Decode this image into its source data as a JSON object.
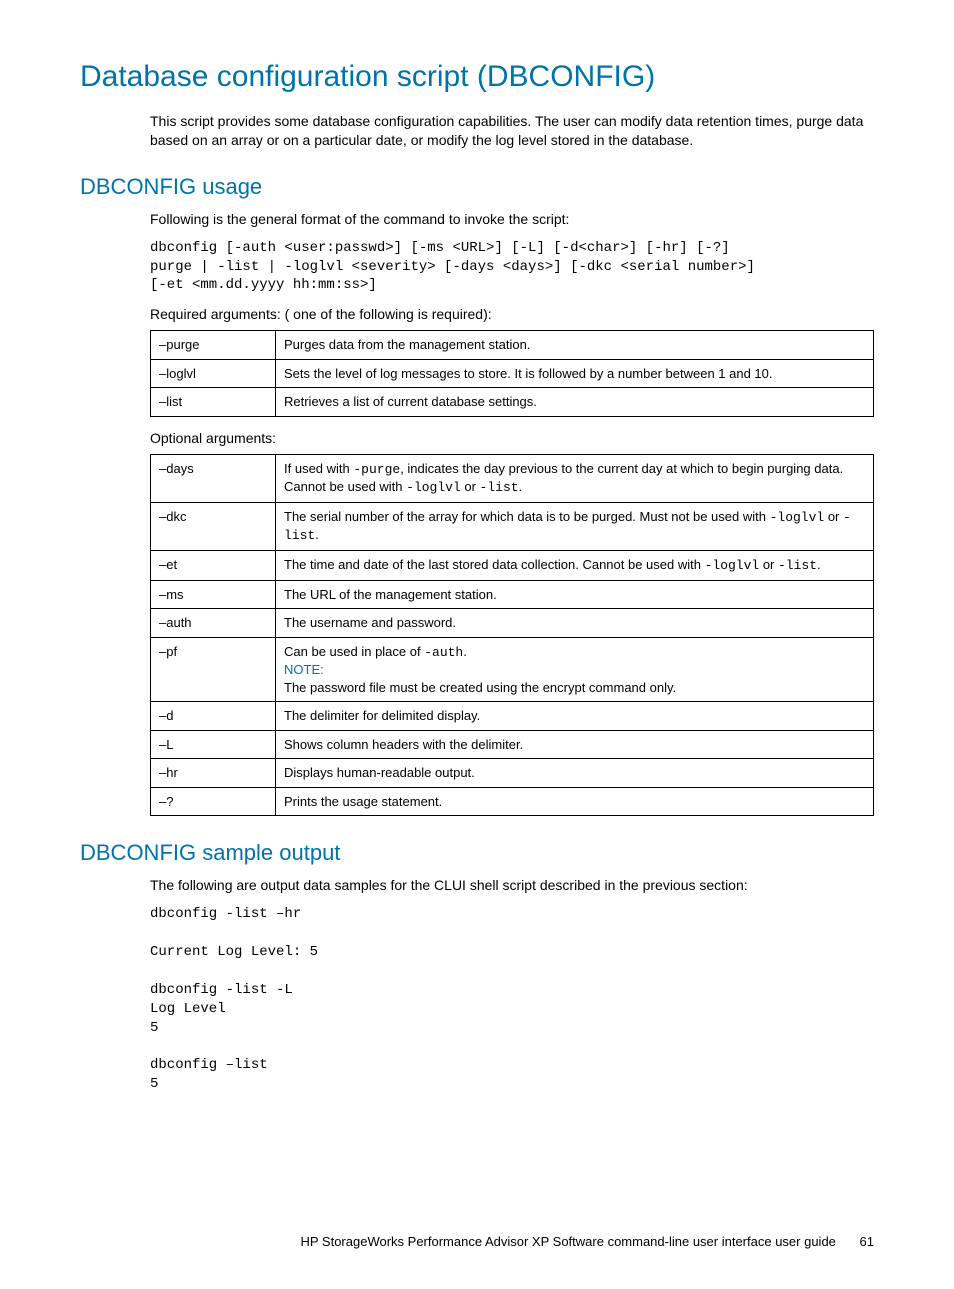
{
  "title": "Database configuration script (DBCONFIG)",
  "intro": "This script provides some database configuration capabilities. The user can modify data retention times, purge data based on an array or on a particular date, or modify the log level stored in the database.",
  "usage": {
    "heading": "DBCONFIG usage",
    "lead": "Following is the general format of the command to invoke the script:",
    "code": "dbconfig [-auth <user:passwd>] [-ms <URL>] [-L] [-d<char>] [-hr] [-?]\npurge | -list | -loglvl <severity> [-days <days>] [-dkc <serial number>]\n[-et <mm.dd.yyyy hh:mm:ss>]",
    "required_label": "Required arguments: ( one of the following is required):",
    "required": [
      {
        "arg": "–purge",
        "desc": "Purges data from the management station."
      },
      {
        "arg": "–loglvl",
        "desc": "Sets the level of log messages to store. It is followed by a number between 1 and 10."
      },
      {
        "arg": "–list",
        "desc": "Retrieves a list of current database settings."
      }
    ],
    "optional_label": "Optional arguments:",
    "optional": {
      "days": {
        "arg": "–days",
        "pre": "If used with ",
        "code1": "-purge",
        "mid": ", indicates the day previous to the current day at which to begin purging data. Cannot be used with ",
        "code2": "-loglvl",
        "mid2": " or ",
        "code3": "-list",
        "post": "."
      },
      "dkc": {
        "arg": "–dkc",
        "pre": "The serial number of the array for which data is to be purged. Must not be used with ",
        "code1": "-loglvl",
        "mid": " or ",
        "code2": "-list",
        "post": "."
      },
      "et": {
        "arg": "–et",
        "pre": "The time and date of the last stored data collection. Cannot be used with ",
        "code1": "-loglvl",
        "mid": " or ",
        "code2": "-list",
        "post": "."
      },
      "ms": {
        "arg": "–ms",
        "desc": "The URL of the management station."
      },
      "auth": {
        "arg": "–auth",
        "desc": "The username and password."
      },
      "pf": {
        "arg": "–pf",
        "pre": "Can be used in place of ",
        "code1": "-auth",
        "post1": ".",
        "note": "NOTE:",
        "note_body": "The password file must be created using the encrypt command only."
      },
      "d": {
        "arg": "–d",
        "desc": "The delimiter for delimited display."
      },
      "L": {
        "arg": "–L",
        "desc": "Shows column headers with the delimiter."
      },
      "hr": {
        "arg": "–hr",
        "desc": "Displays human-readable output."
      },
      "q": {
        "arg": "–?",
        "desc": "Prints the usage statement."
      }
    }
  },
  "sample": {
    "heading": "DBCONFIG sample output",
    "lead": "The following are output data samples for the CLUI shell script described in the previous section:",
    "code": "dbconfig -list –hr\n\nCurrent Log Level: 5\n\ndbconfig -list -L\nLog Level\n5\n\ndbconfig –list\n5"
  },
  "footer": {
    "text": "HP StorageWorks Performance Advisor XP Software command-line user interface user guide",
    "page": "61"
  }
}
